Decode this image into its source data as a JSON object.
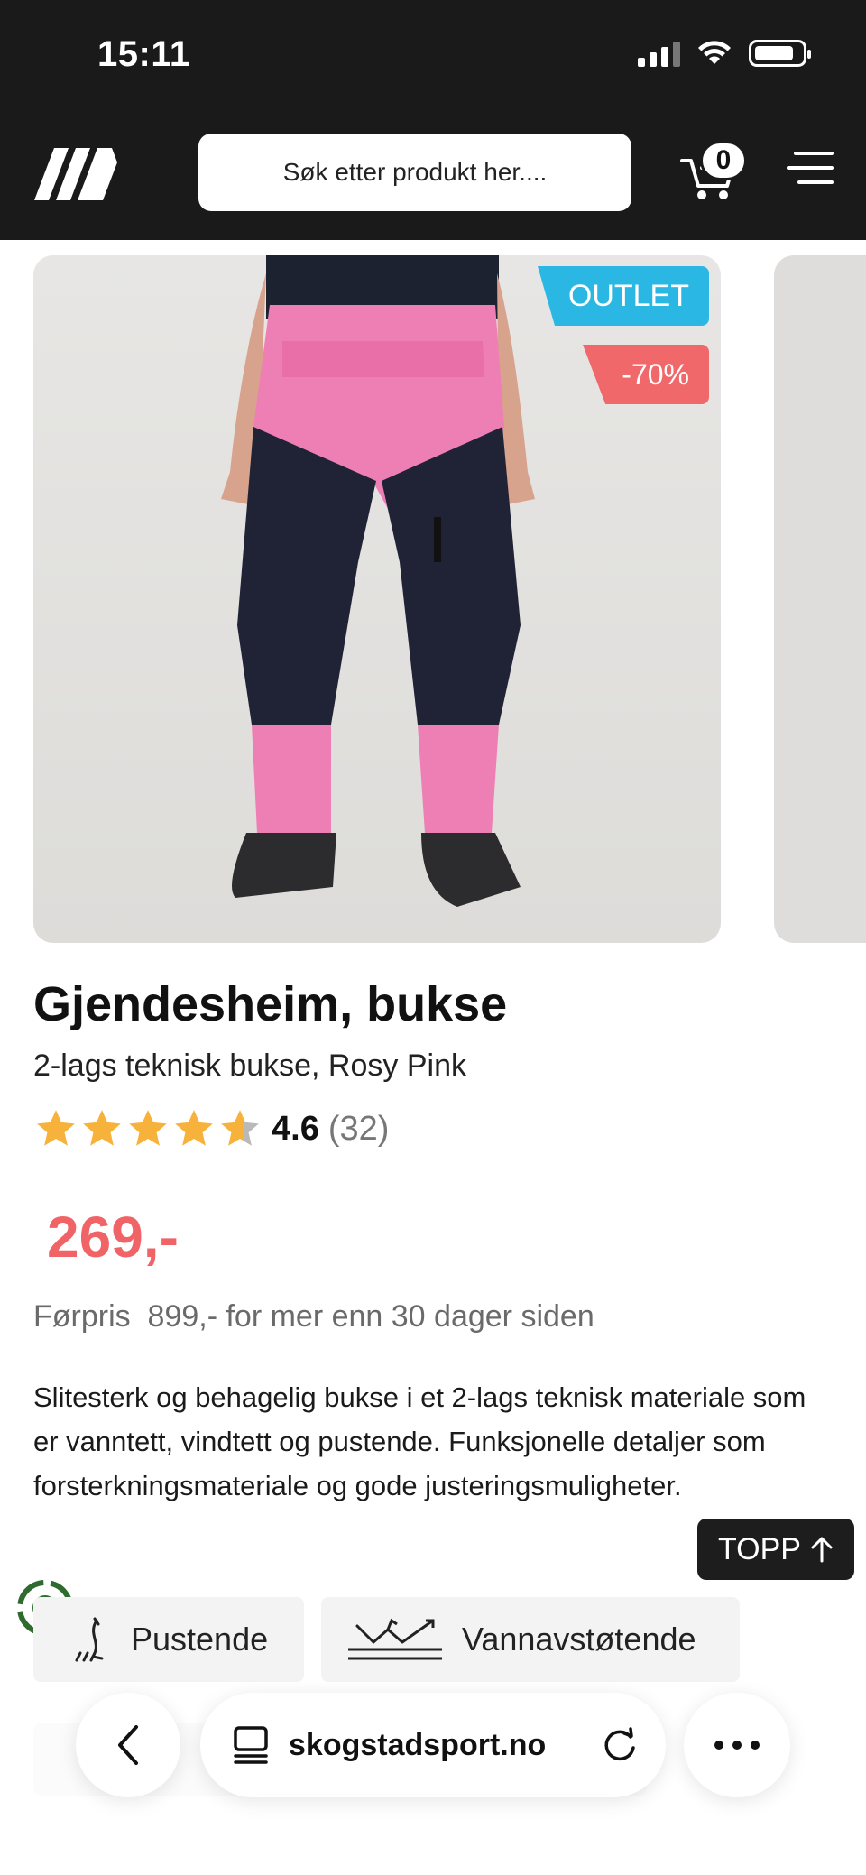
{
  "status_bar": {
    "time": "15:11"
  },
  "header": {
    "search_placeholder": "Søk etter produkt her....",
    "cart_count": "0"
  },
  "product": {
    "badge_outlet": "OUTLET",
    "badge_discount": "-70%",
    "title": "Gjendesheim, bukse",
    "subtitle": "2-lags teknisk bukse, Rosy Pink",
    "rating_value": "4.6",
    "rating_count": "(32)",
    "rating_stars": 4.6,
    "price": "269,-",
    "before_price": "Førpris  899,- for mer enn 30 dager siden",
    "description": "Slitesterk og behagelig bukse i et 2-lags teknisk materiale som er vanntett, vindtett og pustende. Funksjonelle detaljer som forsterkningsmateriale og gode justeringsmuligheter."
  },
  "features": [
    {
      "label": "Pustende",
      "icon": "breathable-icon"
    },
    {
      "label": "Vannavstøtende",
      "icon": "water-repellent-icon"
    }
  ],
  "top_button": {
    "label": "TOPP",
    "icon": "arrow-up-icon"
  },
  "browser": {
    "url": "skogstadsport.no"
  },
  "colors": {
    "header_bg": "#1a1a1a",
    "outlet_badge": "#2bb7e4",
    "discount_badge": "#f0686a",
    "price": "#f06468",
    "star": "#f7b23b"
  }
}
